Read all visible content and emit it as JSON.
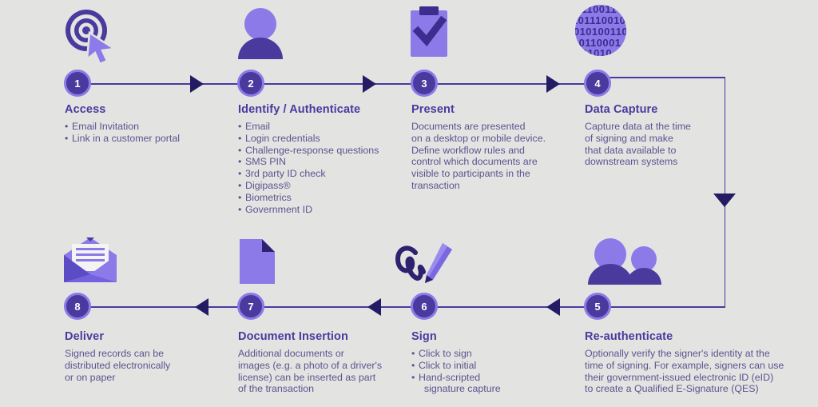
{
  "theme": {
    "background": "#e3e3e1",
    "dark_purple": "#4a3a9e",
    "deep_purple": "#231b63",
    "light_purple": "#8b7ae8",
    "body_text": "#5b5490"
  },
  "steps": [
    {
      "number": "1",
      "title": "Access",
      "icon": "target-cursor-icon",
      "bullets": [
        "Email Invitation",
        "Link in a customer portal"
      ],
      "paragraph": []
    },
    {
      "number": "2",
      "title": "Identify / Authenticate",
      "icon": "person-icon",
      "bullets": [
        "Email",
        "Login credentials",
        "Challenge-response questions",
        "SMS PIN",
        "3rd party ID check",
        "Digipass®",
        "Biometrics",
        "Government ID"
      ],
      "paragraph": []
    },
    {
      "number": "3",
      "title": "Present",
      "icon": "clipboard-check-icon",
      "bullets": [],
      "paragraph": [
        "Documents are presented",
        "on a desktop or mobile device.",
        "Define workflow rules and",
        "control which documents are",
        "visible to participants in the",
        "transaction"
      ]
    },
    {
      "number": "4",
      "title": "Data Capture",
      "icon": "binary-data-icon",
      "bullets": [],
      "paragraph": [
        "Capture data at the time",
        "of signing and make",
        "that data available to",
        "downstream systems"
      ]
    },
    {
      "number": "5",
      "title": "Re-authenticate",
      "icon": "two-people-icon",
      "bullets": [],
      "paragraph": [
        "Optionally verify the signer's identity at the",
        "time of signing. For example, signers can use",
        "their government-issued electronic ID (eID)",
        "to create a Qualified E-Signature (QES)"
      ]
    },
    {
      "number": "6",
      "title": "Sign",
      "icon": "signature-pen-icon",
      "bullets": [
        "Click to sign",
        "Click to initial",
        "Hand-scripted\n  signature capture"
      ],
      "paragraph": []
    },
    {
      "number": "7",
      "title": "Document Insertion",
      "icon": "document-icon",
      "bullets": [],
      "paragraph": [
        "Additional documents or",
        "images (e.g. a photo of a driver's",
        "license) can be inserted as part",
        "of the transaction"
      ]
    },
    {
      "number": "8",
      "title": "Deliver",
      "icon": "open-envelope-icon",
      "bullets": [],
      "paragraph": [
        "Signed records can be",
        "distributed electronically",
        "or on paper"
      ]
    }
  ]
}
